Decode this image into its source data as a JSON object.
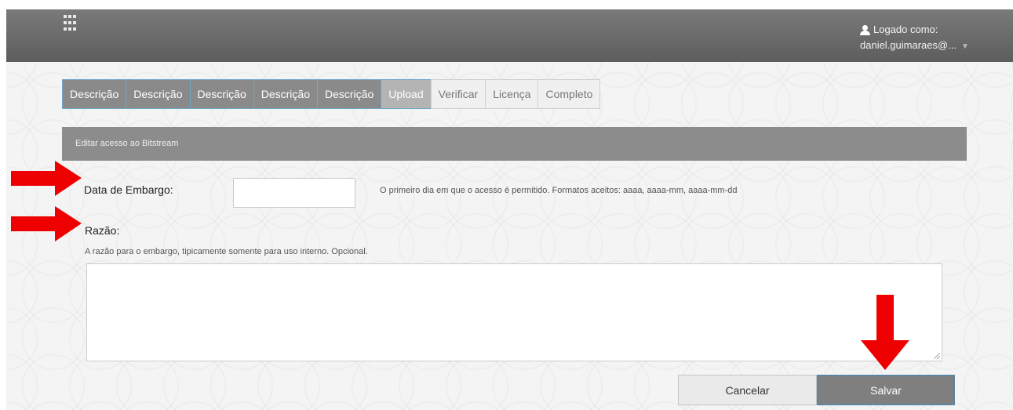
{
  "header": {
    "logged_in_label": "Logado como:",
    "username": "daniel.guimaraes@..."
  },
  "steps": [
    {
      "label": "Descrição",
      "state": "done"
    },
    {
      "label": "Descrição",
      "state": "done"
    },
    {
      "label": "Descrição",
      "state": "done"
    },
    {
      "label": "Descrição",
      "state": "done"
    },
    {
      "label": "Descrição",
      "state": "done"
    },
    {
      "label": "Upload",
      "state": "active"
    },
    {
      "label": "Verificar",
      "state": "todo"
    },
    {
      "label": "Licença",
      "state": "todo"
    },
    {
      "label": "Completo",
      "state": "todo"
    }
  ],
  "panel": {
    "title": "Editar acesso ao Bitstream"
  },
  "form": {
    "embargo_label": "Data de Embargo:",
    "embargo_value": "",
    "embargo_hint": "O primeiro dia em que o acesso é permitido. Formatos aceitos: aaaa, aaaa-mm, aaaa-mm-dd",
    "reason_label": "Razão:",
    "reason_hint": "A razão para o embargo, tipicamente somente para uso interno. Opcional.",
    "reason_value": ""
  },
  "buttons": {
    "cancel": "Cancelar",
    "save": "Salvar"
  },
  "colors": {
    "annotation_arrow": "#ee0000",
    "header_bg": "#6b6b6b",
    "step_border_accent": "#6fa8c7"
  },
  "icons": [
    "apps-grid-icon",
    "user-icon",
    "caret-down-icon"
  ]
}
